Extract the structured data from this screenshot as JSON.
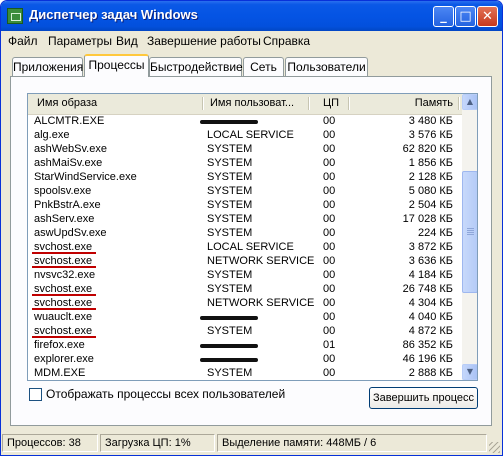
{
  "window": {
    "title": "Диспетчер задач Windows"
  },
  "titlebar": {
    "minimize_glyph": "_",
    "maximize_glyph": "□",
    "close_glyph": "✕"
  },
  "menu": {
    "file": "Файл",
    "options": "Параметры",
    "view": "Вид",
    "shutdown": "Завершение работы",
    "help": "Справка"
  },
  "tabs": {
    "apps": "Приложения",
    "processes": "Процессы",
    "performance": "Быстродействие",
    "network": "Сеть",
    "users": "Пользователи",
    "active": "Процессы"
  },
  "columns": {
    "image": "Имя образа",
    "user": "Имя пользоват...",
    "cpu": "ЦП",
    "mem": "Память"
  },
  "processes": [
    {
      "name": "ALCMTR.EXE",
      "user": "",
      "cpu": "00",
      "mem": "3 480 КБ",
      "redacted": true
    },
    {
      "name": "alg.exe",
      "user": "LOCAL SERVICE",
      "cpu": "00",
      "mem": "3 576 КБ"
    },
    {
      "name": "ashWebSv.exe",
      "user": "SYSTEM",
      "cpu": "00",
      "mem": "62 820 КБ"
    },
    {
      "name": "ashMaiSv.exe",
      "user": "SYSTEM",
      "cpu": "00",
      "mem": "1 856 КБ"
    },
    {
      "name": "StarWindService.exe",
      "user": "SYSTEM",
      "cpu": "00",
      "mem": "2 128 КБ"
    },
    {
      "name": "spoolsv.exe",
      "user": "SYSTEM",
      "cpu": "00",
      "mem": "5 080 КБ"
    },
    {
      "name": "PnkBstrA.exe",
      "user": "SYSTEM",
      "cpu": "00",
      "mem": "2 504 КБ"
    },
    {
      "name": "ashServ.exe",
      "user": "SYSTEM",
      "cpu": "00",
      "mem": "17 028 КБ"
    },
    {
      "name": "aswUpdSv.exe",
      "user": "SYSTEM",
      "cpu": "00",
      "mem": "224 КБ"
    },
    {
      "name": "svchost.exe",
      "user": "LOCAL SERVICE",
      "cpu": "00",
      "mem": "3 872 КБ",
      "underlined": true
    },
    {
      "name": "svchost.exe",
      "user": "NETWORK SERVICE",
      "cpu": "00",
      "mem": "3 636 КБ",
      "underlined": true
    },
    {
      "name": "nvsvc32.exe",
      "user": "SYSTEM",
      "cpu": "00",
      "mem": "4 184 КБ"
    },
    {
      "name": "svchost.exe",
      "user": "SYSTEM",
      "cpu": "00",
      "mem": "26 748 КБ",
      "underlined": true
    },
    {
      "name": "svchost.exe",
      "user": "NETWORK SERVICE",
      "cpu": "00",
      "mem": "4 304 КБ",
      "underlined": true
    },
    {
      "name": "wuauclt.exe",
      "user": "",
      "cpu": "00",
      "mem": "4 040 КБ",
      "redacted": true
    },
    {
      "name": "svchost.exe",
      "user": "SYSTEM",
      "cpu": "00",
      "mem": "4 872 КБ",
      "underlined": true
    },
    {
      "name": "firefox.exe",
      "user": "",
      "cpu": "01",
      "mem": "86 352 КБ",
      "redacted": true
    },
    {
      "name": "explorer.exe",
      "user": "",
      "cpu": "00",
      "mem": "46 196 КБ",
      "redacted": true
    },
    {
      "name": "MDM.EXE",
      "user": "SYSTEM",
      "cpu": "00",
      "mem": "2 888 КБ"
    }
  ],
  "show_all": {
    "label": "Отображать процессы всех пользователей",
    "checked": false
  },
  "end_process": {
    "label": "Завершить процесс"
  },
  "status": {
    "processes": "Процессов: 38",
    "cpu": "Загрузка ЦП: 1%",
    "commit": "Выделение памяти: 448МБ / 6"
  },
  "colors": {
    "title_bar": "#0454e4",
    "face": "#ece9d8",
    "underline": "#c00000"
  }
}
